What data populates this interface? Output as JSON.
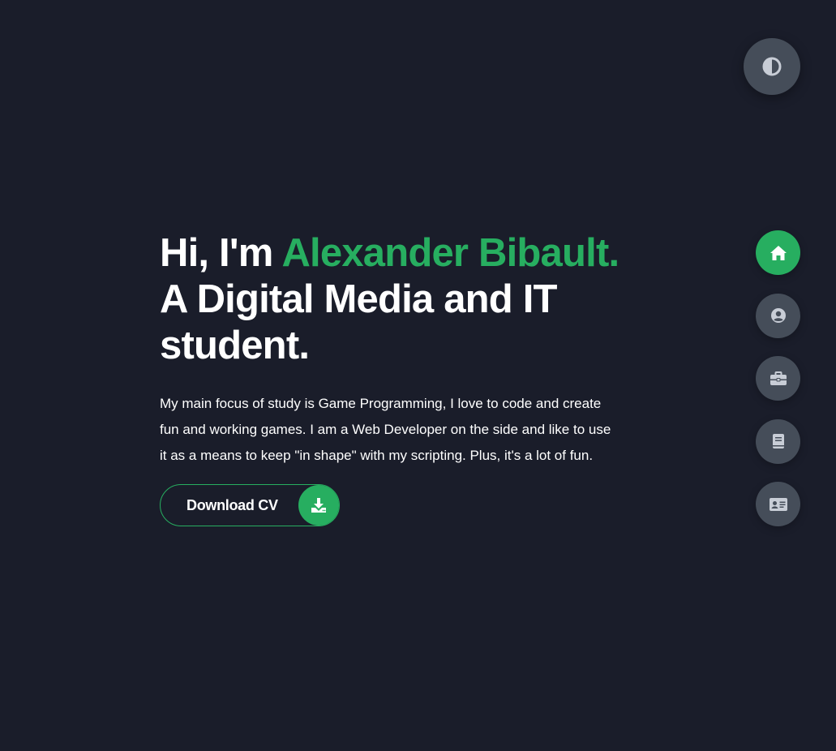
{
  "theme_toggle": {
    "icon": "contrast-icon"
  },
  "hero": {
    "greeting": "Hi, I'm ",
    "name": "Alexander Bibault.",
    "tagline": "A Digital Media and IT student.",
    "description": "My main focus of study is Game Programming, I love to code and create fun and working games. I am a Web Developer on the side and like to use it as a means to keep \"in shape\" with my scripting. Plus, it's a lot of fun.",
    "download_button": {
      "label": "Download CV",
      "icon": "download-icon"
    }
  },
  "nav": {
    "items": [
      {
        "icon": "home-icon",
        "active": true
      },
      {
        "icon": "user-circle-icon",
        "active": false
      },
      {
        "icon": "briefcase-icon",
        "active": false
      },
      {
        "icon": "book-icon",
        "active": false
      },
      {
        "icon": "contact-card-icon",
        "active": false
      }
    ]
  },
  "colors": {
    "background": "#1a1d2a",
    "accent": "#27ae60",
    "control": "#454d59",
    "icon": "#c8cdd6",
    "text": "#ffffff"
  }
}
